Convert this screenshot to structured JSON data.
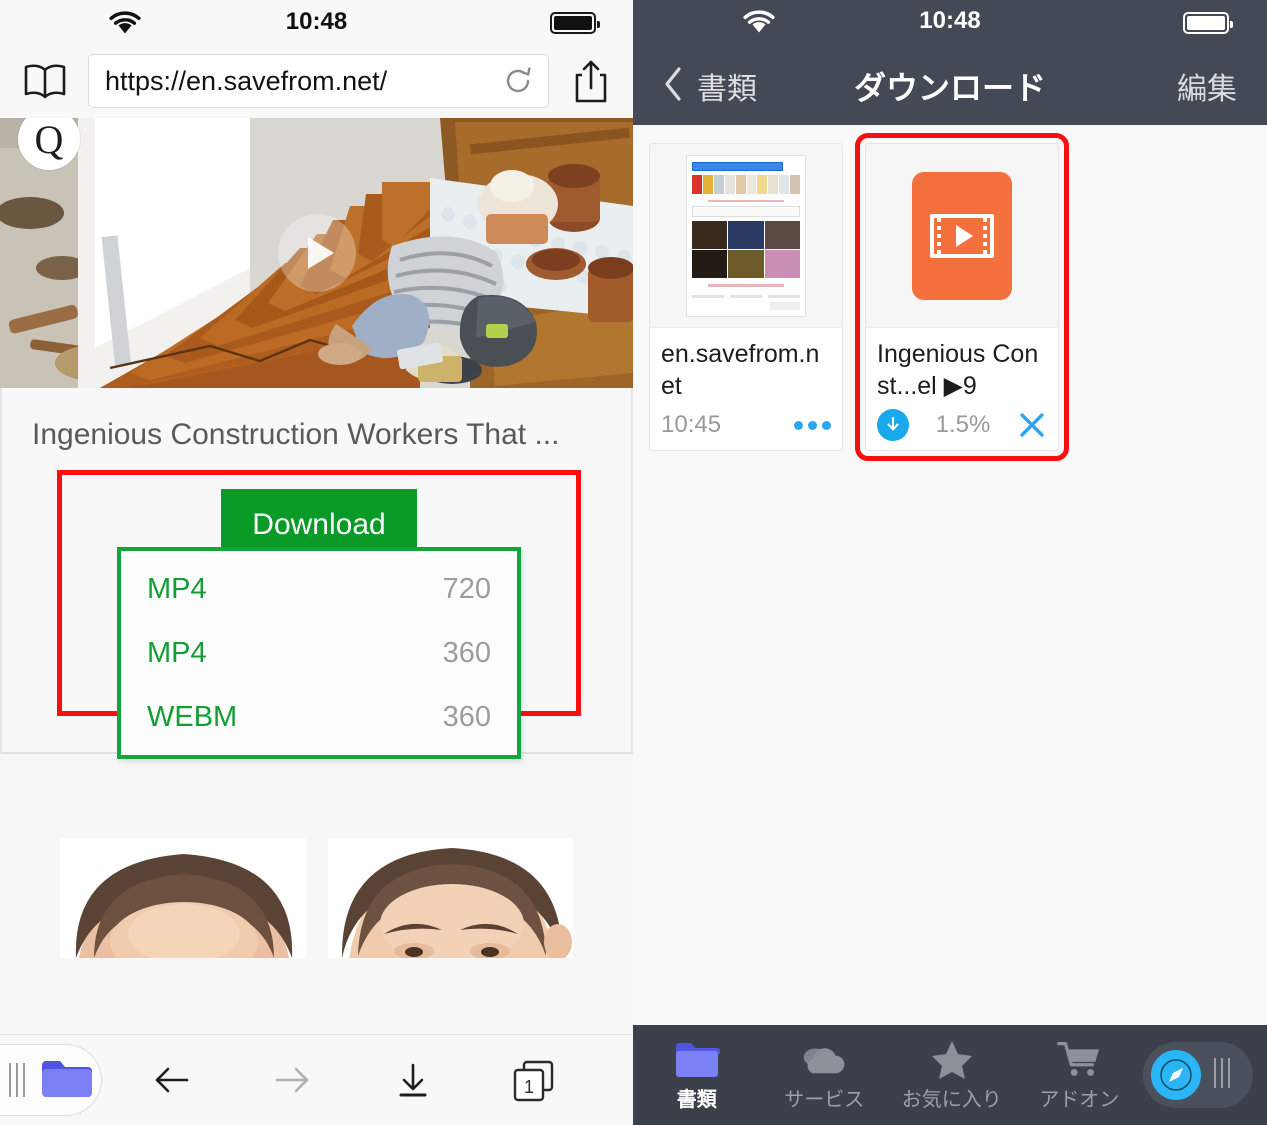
{
  "left_panel": {
    "status_bar": {
      "time": "10:48",
      "wifi_icon": "wifi-icon",
      "battery_icon": "battery-full-icon"
    },
    "url_bar": {
      "bookmarks_icon": "book-icon",
      "url": "https://en.savefrom.net/",
      "reload_icon": "reload-icon",
      "share_icon": "share-icon"
    },
    "hero": {
      "badge": "Q",
      "play_icon": "play-icon",
      "alt": "construction worker installing wooden stair treads"
    },
    "video": {
      "title": "Ingenious Construction Workers That ...",
      "download_button": "Download",
      "formats": [
        {
          "format": "MP4",
          "quality": "720"
        },
        {
          "format": "MP4",
          "quality": "360"
        },
        {
          "format": "WEBM",
          "quality": "360"
        }
      ]
    },
    "toolbar": {
      "grip_icon": "grip-handle-icon",
      "folder_icon": "folder-icon",
      "back_icon": "arrow-left-icon",
      "forward_icon": "arrow-right-icon",
      "downloads_icon": "download-arrow-icon",
      "tabs_icon": "tabs-icon",
      "tab_count": "1"
    }
  },
  "right_panel": {
    "status_bar": {
      "time": "10:48",
      "wifi_icon": "wifi-icon",
      "battery_icon": "battery-full-icon"
    },
    "nav": {
      "back_icon": "chevron-left-icon",
      "back_label": "書類",
      "title": "ダウンロード",
      "edit_label": "編集"
    },
    "files": [
      {
        "name": "en.savefrom.net",
        "time": "10:45",
        "menu_icon": "more-dots-icon",
        "thumb_type": "webpage-preview",
        "highlighted": false
      },
      {
        "name": "Ingenious Const...el ▶9",
        "progress": "1.5%",
        "download_icon": "download-circle-icon",
        "cancel_icon": "close-x-icon",
        "thumb_type": "video-file-icon",
        "highlighted": true
      }
    ],
    "tabbar": [
      {
        "label": "書類",
        "icon": "folder-icon",
        "active": true
      },
      {
        "label": "サービス",
        "icon": "cloud-icon",
        "active": false
      },
      {
        "label": "お気に入り",
        "icon": "star-icon",
        "active": false
      },
      {
        "label": "アドオン",
        "icon": "cart-icon",
        "active": false
      }
    ],
    "safari_button": {
      "icon": "safari-compass-icon",
      "grip_icon": "grip-handle-icon"
    }
  },
  "colors": {
    "accent_green": "#0a9a27",
    "list_border_green": "#0ea83a",
    "highlight_red": "#f80f0f",
    "video_orange": "#f4703c",
    "header_slate": "#434a55",
    "tabbar_slate": "#3b404a",
    "blue_accent": "#19a8ec",
    "folder_blue": "#7b80f5"
  }
}
